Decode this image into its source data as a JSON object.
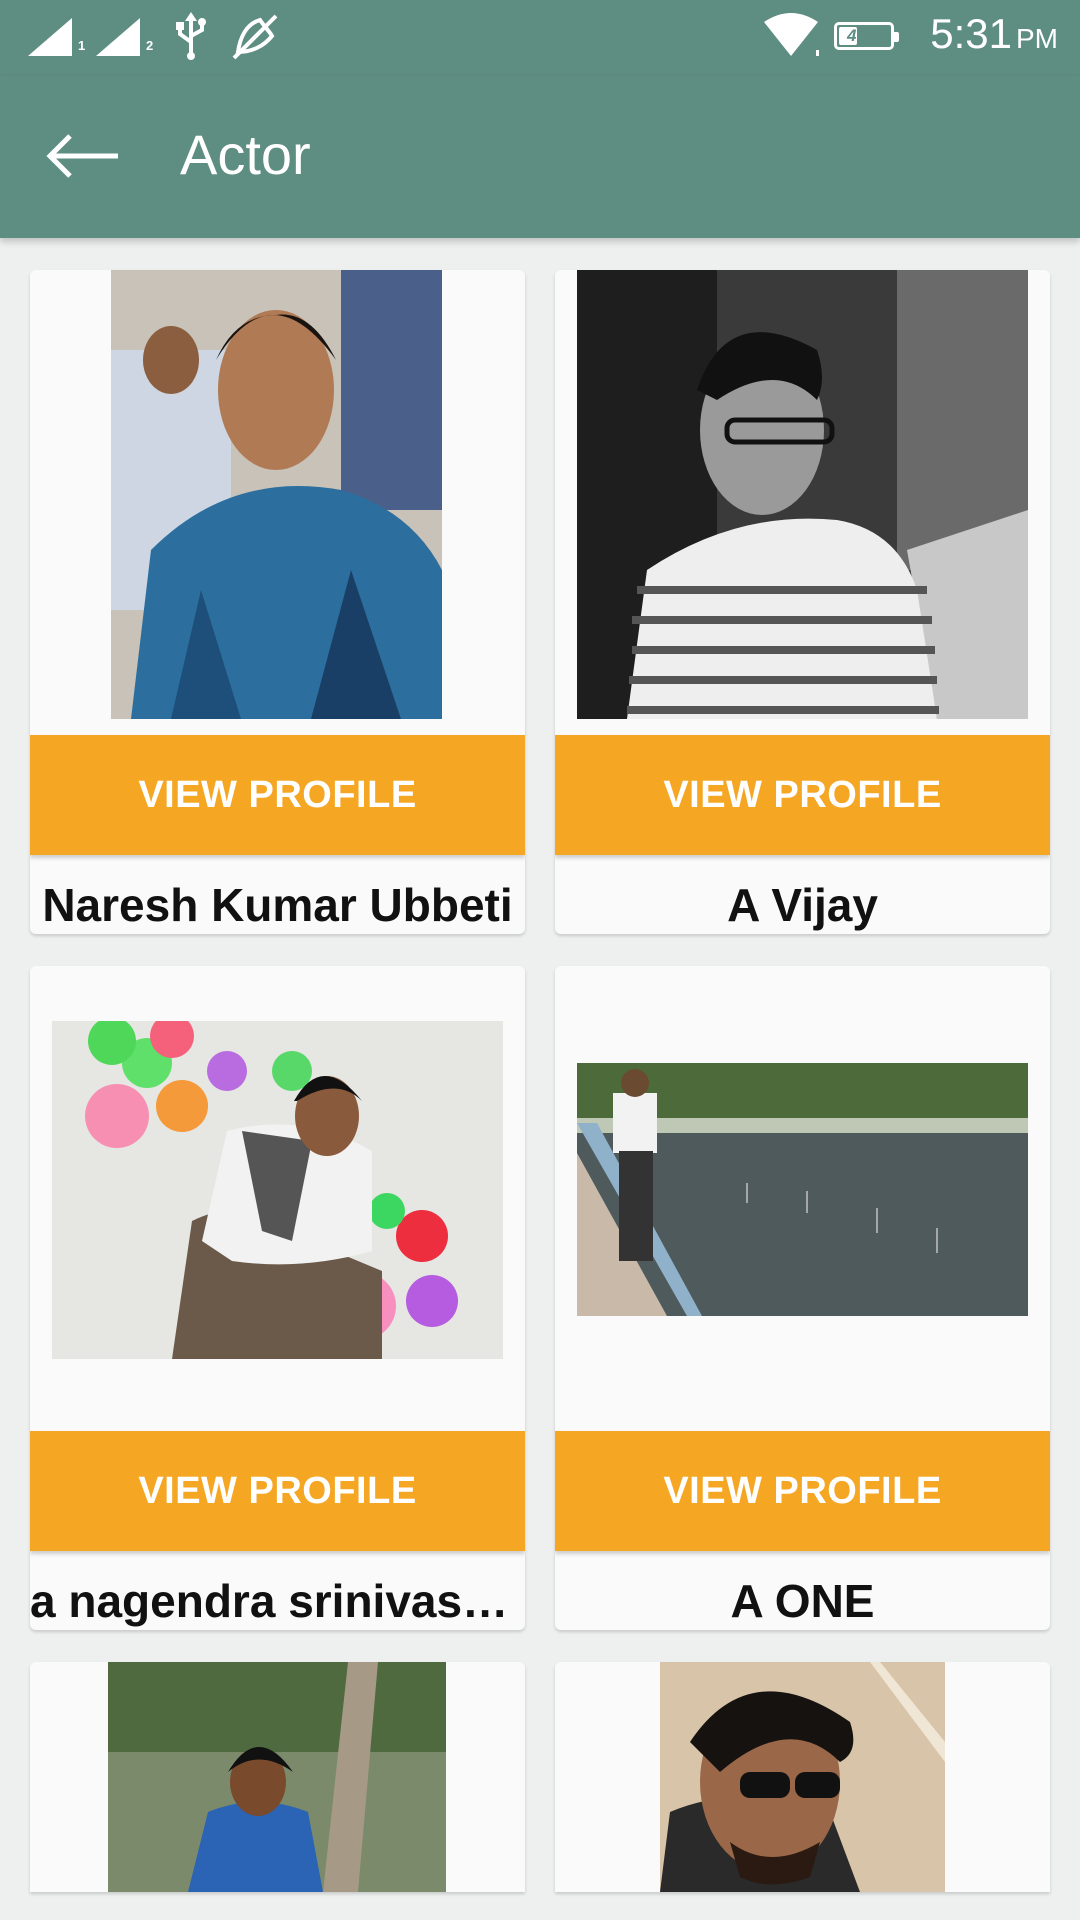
{
  "status_bar": {
    "sim1_label": "1",
    "sim2_label": "2",
    "icons": [
      "signal-sim1-icon",
      "signal-sim2-icon",
      "usb-icon",
      "no-notifications-icon",
      "wifi-icon",
      "battery-icon"
    ],
    "battery_percent": "40%",
    "battery_level": 0.4,
    "time": "5:31",
    "ampm": "PM"
  },
  "app_bar": {
    "back_icon": "arrow-left-icon",
    "title": "Actor"
  },
  "profiles": [
    {
      "name": "Naresh Kumar Ubbeti",
      "button_label": "VIEW PROFILE",
      "photo": "man in blue plaid shirt"
    },
    {
      "name": "A Vijay",
      "button_label": "VIEW PROFILE",
      "photo": "black-and-white portrait with glasses"
    },
    {
      "name": "a nagendra srinivasa…",
      "button_label": "VIEW PROFILE",
      "photo": "man sitting among balloons"
    },
    {
      "name": "A ONE",
      "button_label": "VIEW PROFILE",
      "photo": "man standing by fountain"
    },
    {
      "name": "",
      "button_label": "",
      "photo": "woman by a tree"
    },
    {
      "name": "",
      "button_label": "",
      "photo": "man with sunglasses"
    }
  ],
  "colors": {
    "app_bar": "#5e8d82",
    "button": "#f5a623",
    "background": "#eef0f0",
    "card": "#fafafa"
  }
}
